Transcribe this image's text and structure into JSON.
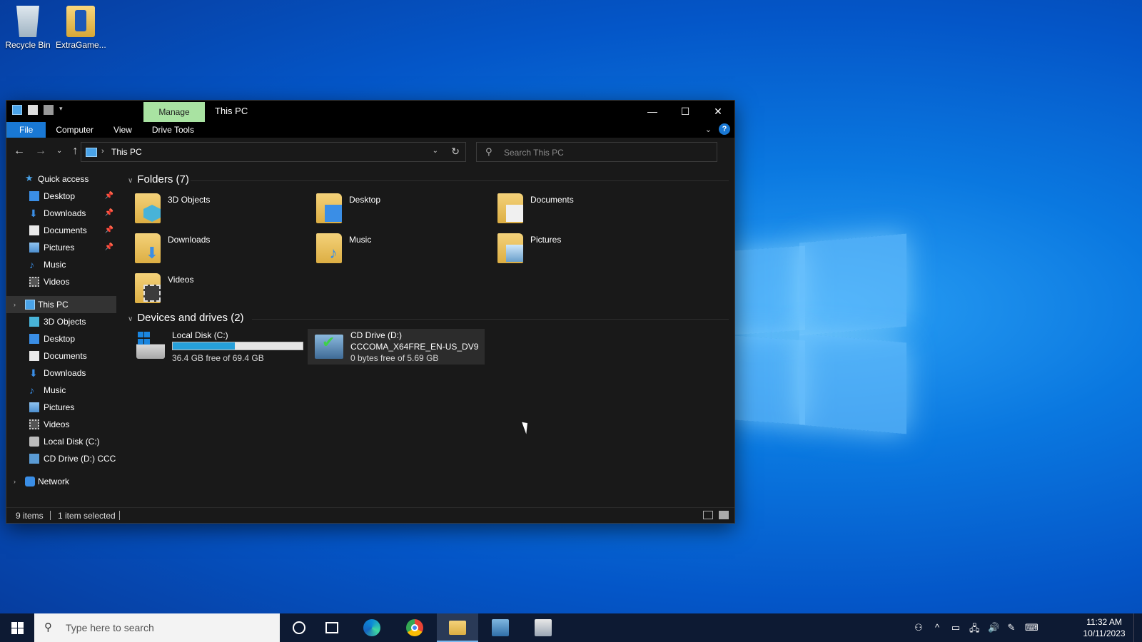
{
  "desktop": {
    "icons": [
      {
        "label": "Recycle Bin",
        "icon": "recycle-bin-icon"
      },
      {
        "label": "ExtraGame...",
        "icon": "game-folder-icon"
      }
    ]
  },
  "window": {
    "title": "This PC",
    "context_tab": "Manage",
    "controls": {
      "minimize": "—",
      "maximize": "☐",
      "close": "✕"
    },
    "ribbon_tabs": [
      "File",
      "Computer",
      "View",
      "Drive Tools"
    ],
    "help_label": "?",
    "collapse_label": "⌄"
  },
  "address_bar": {
    "back": "←",
    "forward": "→",
    "recent": "⌄",
    "up": "↑",
    "separator": "›",
    "path": "This PC",
    "dropdown": "⌄",
    "refresh": "↻",
    "search_placeholder": "Search This PC",
    "search_icon": "⚲"
  },
  "nav_pane": {
    "quick_access": {
      "label": "Quick access",
      "items": [
        {
          "label": "Desktop",
          "icon": "desktop-icon",
          "pinned": true
        },
        {
          "label": "Downloads",
          "icon": "downloads-icon",
          "pinned": true
        },
        {
          "label": "Documents",
          "icon": "documents-icon",
          "pinned": true
        },
        {
          "label": "Pictures",
          "icon": "pictures-icon",
          "pinned": true
        },
        {
          "label": "Music",
          "icon": "music-icon",
          "pinned": false
        },
        {
          "label": "Videos",
          "icon": "videos-icon",
          "pinned": false
        }
      ]
    },
    "this_pc": {
      "label": "This PC",
      "items": [
        {
          "label": "3D Objects",
          "icon": "3d-objects-icon"
        },
        {
          "label": "Desktop",
          "icon": "desktop-icon"
        },
        {
          "label": "Documents",
          "icon": "documents-icon"
        },
        {
          "label": "Downloads",
          "icon": "downloads-icon"
        },
        {
          "label": "Music",
          "icon": "music-icon"
        },
        {
          "label": "Pictures",
          "icon": "pictures-icon"
        },
        {
          "label": "Videos",
          "icon": "videos-icon"
        },
        {
          "label": "Local Disk (C:)",
          "icon": "local-disk-icon"
        },
        {
          "label": "CD Drive (D:) CCCO",
          "icon": "cd-drive-icon"
        }
      ]
    },
    "network": {
      "label": "Network",
      "icon": "network-icon"
    },
    "pin_glyph": "📌"
  },
  "content": {
    "folders_header": "Folders (7)",
    "folders": [
      {
        "name": "3D Objects",
        "icon": "3d-objects-folder-icon"
      },
      {
        "name": "Desktop",
        "icon": "desktop-folder-icon"
      },
      {
        "name": "Documents",
        "icon": "documents-folder-icon"
      },
      {
        "name": "Downloads",
        "icon": "downloads-folder-icon"
      },
      {
        "name": "Music",
        "icon": "music-folder-icon"
      },
      {
        "name": "Pictures",
        "icon": "pictures-folder-icon"
      },
      {
        "name": "Videos",
        "icon": "videos-folder-icon"
      }
    ],
    "devices_header": "Devices and drives (2)",
    "drives": [
      {
        "name": "Local Disk (C:)",
        "free_text": "36.4 GB free of 69.4 GB",
        "used_fraction": 0.476,
        "icon": "local-disk-icon"
      },
      {
        "name": "CD Drive (D:)",
        "volume": "CCCOMA_X64FRE_EN-US_DV9",
        "free_text": "0 bytes free of 5.69 GB",
        "icon": "cd-drive-icon"
      }
    ]
  },
  "status_bar": {
    "item_count": "9 items",
    "selection": "1 item selected"
  },
  "taskbar": {
    "search_placeholder": "Type here to search",
    "clock_time": "11:32 AM",
    "clock_date": "10/11/2023",
    "tray_icons": [
      "people-icon",
      "chevron-up-icon",
      "tablet-icon",
      "network-icon",
      "volume-icon",
      "pen-icon",
      "keyboard-icon"
    ],
    "tray_glyphs": [
      "⚇",
      "^",
      "▭",
      "🖧",
      "🔊",
      "✎",
      "⌨"
    ]
  },
  "colors": {
    "accent": "#1978d4",
    "manage_tab": "#a9e3a2",
    "window_bg": "#191919",
    "drive_bar": "#26a0da",
    "taskbar": "#0d1a33"
  }
}
